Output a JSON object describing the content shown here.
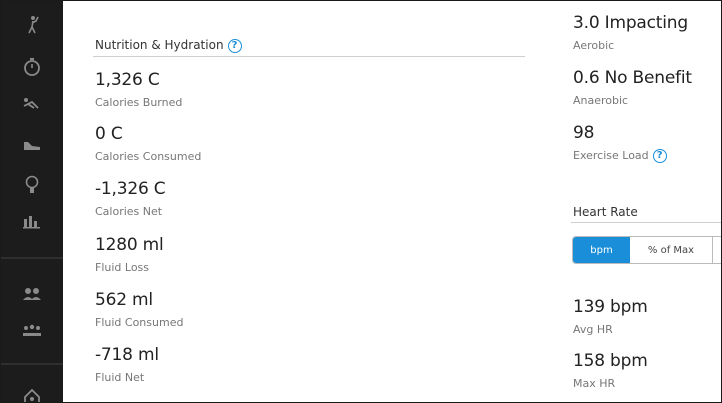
{
  "sidebar": {
    "icons": [
      "golf-icon",
      "stopwatch-icon",
      "swimmer-icon",
      "shoe-icon",
      "lightbulb-icon",
      "bar-chart-icon",
      "group-icon",
      "team-icon",
      "home-icon"
    ]
  },
  "nutrition": {
    "title": "Nutrition & Hydration",
    "help": "?",
    "stats": [
      {
        "value": "1,326 C",
        "label": "Calories Burned"
      },
      {
        "value": "0 C",
        "label": "Calories Consumed"
      },
      {
        "value": "-1,326 C",
        "label": "Calories Net"
      },
      {
        "value": "1280 ml",
        "label": "Fluid Loss"
      },
      {
        "value": "562 ml",
        "label": "Fluid Consumed"
      },
      {
        "value": "-718 ml",
        "label": "Fluid Net"
      }
    ]
  },
  "training": {
    "stats": [
      {
        "value": "3.0 Impacting",
        "label": "Aerobic"
      },
      {
        "value": "0.6 No Benefit",
        "label": "Anaerobic"
      },
      {
        "value": "98",
        "label": "Exercise Load",
        "help": "?"
      }
    ]
  },
  "heart_rate": {
    "title": "Heart Rate",
    "tabs": [
      {
        "label": "bpm",
        "active": true
      },
      {
        "label": "% of Max",
        "active": false
      }
    ],
    "stats": [
      {
        "value": "139 bpm",
        "label": "Avg HR"
      },
      {
        "value": "158 bpm",
        "label": "Max HR"
      }
    ]
  },
  "colors": {
    "accent": "#1a8ed8",
    "sidebar": "#1c1c1c"
  }
}
